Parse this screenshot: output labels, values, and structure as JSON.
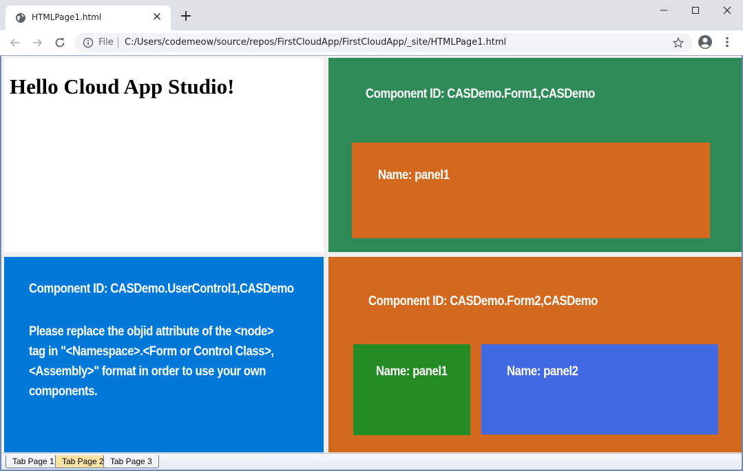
{
  "browser": {
    "tab_title": "HTMLPage1.html",
    "address": {
      "scheme_label": "File",
      "url": "C:/Users/codemeow/source/repos/FirstCloudApp/FirstCloudApp/_site/HTMLPage1.html"
    }
  },
  "page": {
    "hello_title": "Hello Cloud App Studio!",
    "form1": {
      "component_label": "Component ID: CASDemo.Form1,CASDemo",
      "panel1_label": "Name: panel1"
    },
    "usercontrol1": {
      "component_label": "Component ID: CASDemo.UserControl1,CASDemo",
      "message": "Please replace the objid attribute of the <node> tag in \"<Namespace>.<Form or Control Class>,<Assembly>\" format in order to use your own components."
    },
    "form2": {
      "component_label": "Component ID: CASDemo.Form2,CASDemo",
      "panel1_label": "Name: panel1",
      "panel2_label": "Name: panel2"
    },
    "tabs": [
      {
        "label": "Tab Page 1"
      },
      {
        "label": "Tab Page 2"
      },
      {
        "label": "Tab Page 3"
      }
    ]
  },
  "colors": {
    "form1_bg": "#2e8b57",
    "form1_panel1_bg": "#d2691e",
    "usercontrol1_bg": "#0078d7",
    "form2_bg": "#d2691e",
    "form2_panel1_bg": "#228b22",
    "form2_panel2_bg": "#4169e1"
  },
  "icons": {
    "favicon": "globe-icon",
    "tab_close": "close-icon",
    "new_tab": "plus-icon",
    "back": "arrow-left-icon",
    "forward": "arrow-right-icon",
    "reload": "reload-icon",
    "site_info": "info-icon",
    "bookmark": "star-icon",
    "profile": "account-icon",
    "menu": "more-vertical-icon"
  }
}
